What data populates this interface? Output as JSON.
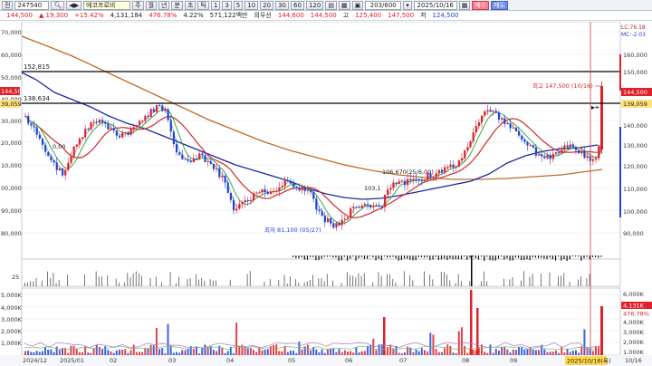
{
  "toolbar": {
    "code_label": "전",
    "code": "247540",
    "name": "에코프로비",
    "periods": [
      "주",
      "월",
      "년",
      "분",
      "초",
      "틱"
    ],
    "intervals": [
      "1",
      "3",
      "5",
      "10",
      "20",
      "30",
      "60",
      "120"
    ],
    "count": "203/600",
    "date": "2025/10/16",
    "buy": "매수",
    "sell": "매도"
  },
  "quote": {
    "price": "144,500",
    "change": "▲ 19,300",
    "rate": "+15.42%",
    "volume": "4,131,184",
    "vol_rate": "476.78%",
    "turnover": "4.22%",
    "amount": "571,122백만",
    "tag": "외우선",
    "open": "144,600",
    "open2": "144,500",
    "high_label": "고",
    "high": "125,400",
    "high2": "147,500",
    "low_label": "저",
    "low": "124,500"
  },
  "price_axis": {
    "ticks": [
      "70,000",
      "60,000",
      "50,000",
      "40,000",
      "30,000",
      "20,000",
      "10,000",
      "00,000",
      "90,000",
      "80,000"
    ],
    "right_ticks": [
      "160,000",
      "150,000",
      "140,000",
      "130,000",
      "120,000",
      "110,000",
      "100,000",
      "90,000",
      "80,000"
    ],
    "current_tag": "144,500",
    "current_tag_left": "144,500",
    "line_tag": "139,059",
    "line_tag_left": "39,059"
  },
  "annotations": {
    "level_1": "152,815",
    "level_2": "138,634",
    "high_note": "최고 147,500 (10/16)",
    "low_note": "최저 81,100 (05/27)",
    "mid_note_1": "106,670(25/6,00)",
    "mid_note_2": "103,1",
    "left_note": "0,00"
  },
  "indicators": {
    "lc": "LC:76.18",
    "mc": "MC:-2.03",
    "osc_tick": "25"
  },
  "volume_axis": {
    "ticks": [
      "5,000K",
      "4,000K",
      "3,000K",
      "2,000K",
      "1,000K"
    ],
    "right_ticks": [
      "6,000K",
      "5,000K",
      "4,000K",
      "3,000K",
      "2,000K",
      "1,000K"
    ],
    "tag_1": "4,131K",
    "tag_2": "476.78%"
  },
  "x_axis": {
    "labels": [
      "2024/12",
      "2025/01",
      "02",
      "03",
      "04",
      "05",
      "06",
      "07",
      "08",
      "09"
    ],
    "cursor_date": "2025/10/16(목)",
    "last": "10/16"
  },
  "colors": {
    "up": "#e0202a",
    "down": "#1e46d6",
    "ma_short": "#2e9d3a",
    "ma_mid": "#d22a2a",
    "ma_long": "#1c2a9c",
    "ma_longest": "#c06a2a"
  }
}
